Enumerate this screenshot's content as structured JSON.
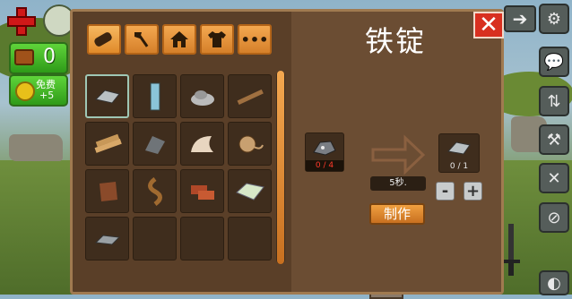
{
  "hud": {
    "chest_value": "0",
    "free_label": "免费",
    "free_bonus": "+5"
  },
  "craft_panel": {
    "title": "铁锭",
    "close_label": "✕",
    "tabs": [
      {
        "name": "tab-resources",
        "icon": "log-icon",
        "active": true
      },
      {
        "name": "tab-tools",
        "icon": "axe-icon",
        "active": false
      },
      {
        "name": "tab-building",
        "icon": "house-icon",
        "active": false
      },
      {
        "name": "tab-clothing",
        "icon": "shirt-icon",
        "active": false
      },
      {
        "name": "tab-more",
        "icon": "more-icon",
        "label": "•••",
        "active": false
      }
    ],
    "items": [
      {
        "icon": "iron-ingot-icon",
        "selected": true
      },
      {
        "icon": "glass-icon"
      },
      {
        "icon": "stone-pile-icon"
      },
      {
        "icon": "branch-icon"
      },
      {
        "icon": "planks-icon"
      },
      {
        "icon": "rock-shard-icon"
      },
      {
        "icon": "hide-icon"
      },
      {
        "icon": "rope-spool-icon"
      },
      {
        "icon": "leather-icon"
      },
      {
        "icon": "rope-icon"
      },
      {
        "icon": "brick-icon"
      },
      {
        "icon": "cement-block-icon"
      },
      {
        "icon": "metal-bar-icon"
      },
      {
        "icon": "empty"
      },
      {
        "icon": "empty"
      },
      {
        "icon": "empty"
      }
    ],
    "ingredient": {
      "icon": "iron-ore-icon",
      "count": "0 / 4"
    },
    "output": {
      "icon": "iron-ingot-icon",
      "count": "0 / 1"
    },
    "time": "5秒.",
    "minus_label": "-",
    "plus_label": "+",
    "craft_label": "制作"
  },
  "colors": {
    "panel_bg": "#5a3f28",
    "tab_orange": "#e08a2a",
    "close_red": "#d83020",
    "hud_green": "#3fb023"
  }
}
